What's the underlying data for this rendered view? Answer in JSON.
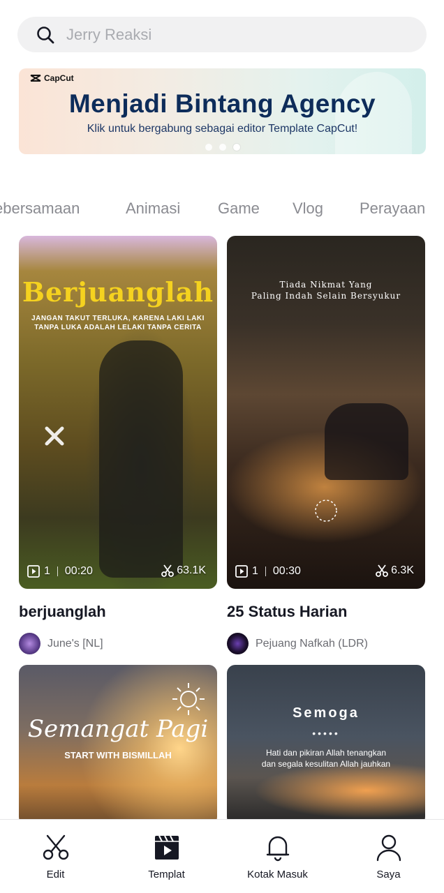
{
  "search": {
    "placeholder": "Jerry Reaksi",
    "icon": "search-icon"
  },
  "banner": {
    "logo": "CapCut",
    "title": "Menjadi Bintang Agency",
    "subtitle": "Klik untuk bergabung sebagai editor Template CapCut!",
    "dots_total": 3,
    "active_dot": 3
  },
  "categories": [
    "ebersamaan",
    "Animasi",
    "Game",
    "Vlog",
    "Perayaan"
  ],
  "cards": [
    {
      "overlay_title": "Berjuanglah",
      "overlay_lines": [
        "JANGAN TAKUT TERLUKA, KARENA LAKI LAKI",
        "TANPA LUKA ADALAH LELAKI TANPA CERITA"
      ],
      "clips": "1",
      "duration": "00:20",
      "uses": "63.1K",
      "title": "berjuanglah",
      "author": "June's [NL]"
    },
    {
      "overlay_lines": [
        "Tiada Nikmat Yang",
        "Paling Indah Selain Bersyukur"
      ],
      "clips": "1",
      "duration": "00:30",
      "uses": "6.3K",
      "title": "25 Status Harian",
      "author": "Pejuang Nafkah (LDR)"
    },
    {
      "overlay_title": "Semangat Pagi",
      "overlay_lines": [
        "START WITH BISMILLAH"
      ]
    },
    {
      "overlay_title": "Semoga",
      "overlay_lines": [
        "Hati dan pikiran Allah tenangkan",
        "dan segala kesulitan Allah jauhkan"
      ]
    }
  ],
  "tabbar": {
    "items": [
      {
        "label": "Edit",
        "icon": "scissors-icon"
      },
      {
        "label": "Templat",
        "icon": "clapper-icon"
      },
      {
        "label": "Kotak Masuk",
        "icon": "bell-icon"
      },
      {
        "label": "Saya",
        "icon": "person-icon"
      }
    ],
    "active": "Templat"
  },
  "colors": {
    "text": "#161823",
    "muted": "#8a8b91",
    "banner_title": "#0d2c5a",
    "overlay_yellow": "#f5d21f"
  }
}
